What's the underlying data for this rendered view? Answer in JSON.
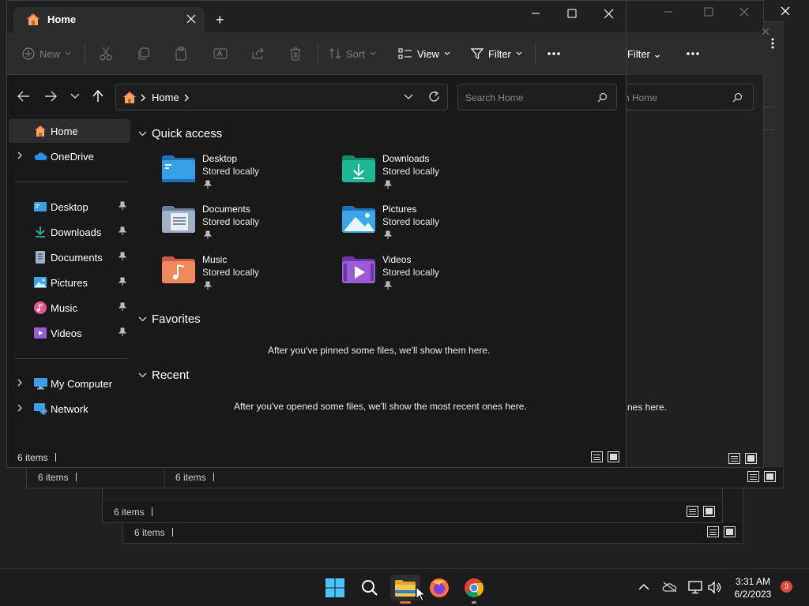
{
  "window": {
    "tab_title": "Home",
    "new_tab": "+"
  },
  "toolbar": {
    "new_label": "New",
    "sort_label": "Sort",
    "view_label": "View",
    "filter_label": "Filter",
    "more_label": "..."
  },
  "address": {
    "crumb": "Home",
    "search_placeholder": "Search Home"
  },
  "sidebar": {
    "items": [
      {
        "label": "Home",
        "icon": "home-icon"
      },
      {
        "label": "OneDrive",
        "icon": "cloud-icon"
      },
      {
        "label": "Desktop",
        "icon": "desktop-icon"
      },
      {
        "label": "Downloads",
        "icon": "download-icon"
      },
      {
        "label": "Documents",
        "icon": "documents-icon"
      },
      {
        "label": "Pictures",
        "icon": "pictures-icon"
      },
      {
        "label": "Music",
        "icon": "music-icon"
      },
      {
        "label": "Videos",
        "icon": "videos-icon"
      },
      {
        "label": "My Computer",
        "icon": "computer-icon"
      },
      {
        "label": "Network",
        "icon": "network-icon"
      }
    ]
  },
  "content": {
    "quick_access_title": "Quick access",
    "favorites_title": "Favorites",
    "recent_title": "Recent",
    "favorites_msg": "After you've pinned some files, we'll show them here.",
    "recent_msg": "After you've opened some files, we'll show the most recent ones here.",
    "quick_access": [
      {
        "name": "Desktop",
        "status": "Stored locally",
        "color": "#3aa0e6"
      },
      {
        "name": "Downloads",
        "status": "Stored locally",
        "color": "#1eb894"
      },
      {
        "name": "Documents",
        "status": "Stored locally",
        "color": "#8fa3bd"
      },
      {
        "name": "Pictures",
        "status": "Stored locally",
        "color": "#3ba7e8"
      },
      {
        "name": "Music",
        "status": "Stored locally",
        "color": "#f08a5d"
      },
      {
        "name": "Videos",
        "status": "Stored locally",
        "color": "#9c5bd6"
      }
    ]
  },
  "status": {
    "count": "6 items"
  },
  "background_windows": {
    "count": "6 items",
    "filter_label": "Filter",
    "search_placeholder_partial": "h Home",
    "recent_msg_partial": "nes here."
  },
  "taskbar": {
    "time": "3:31 AM",
    "date": "6/2/2023",
    "notifications": "3"
  },
  "colors": {
    "accent": "#e86f48",
    "folder_yellow": "#f7c948"
  }
}
